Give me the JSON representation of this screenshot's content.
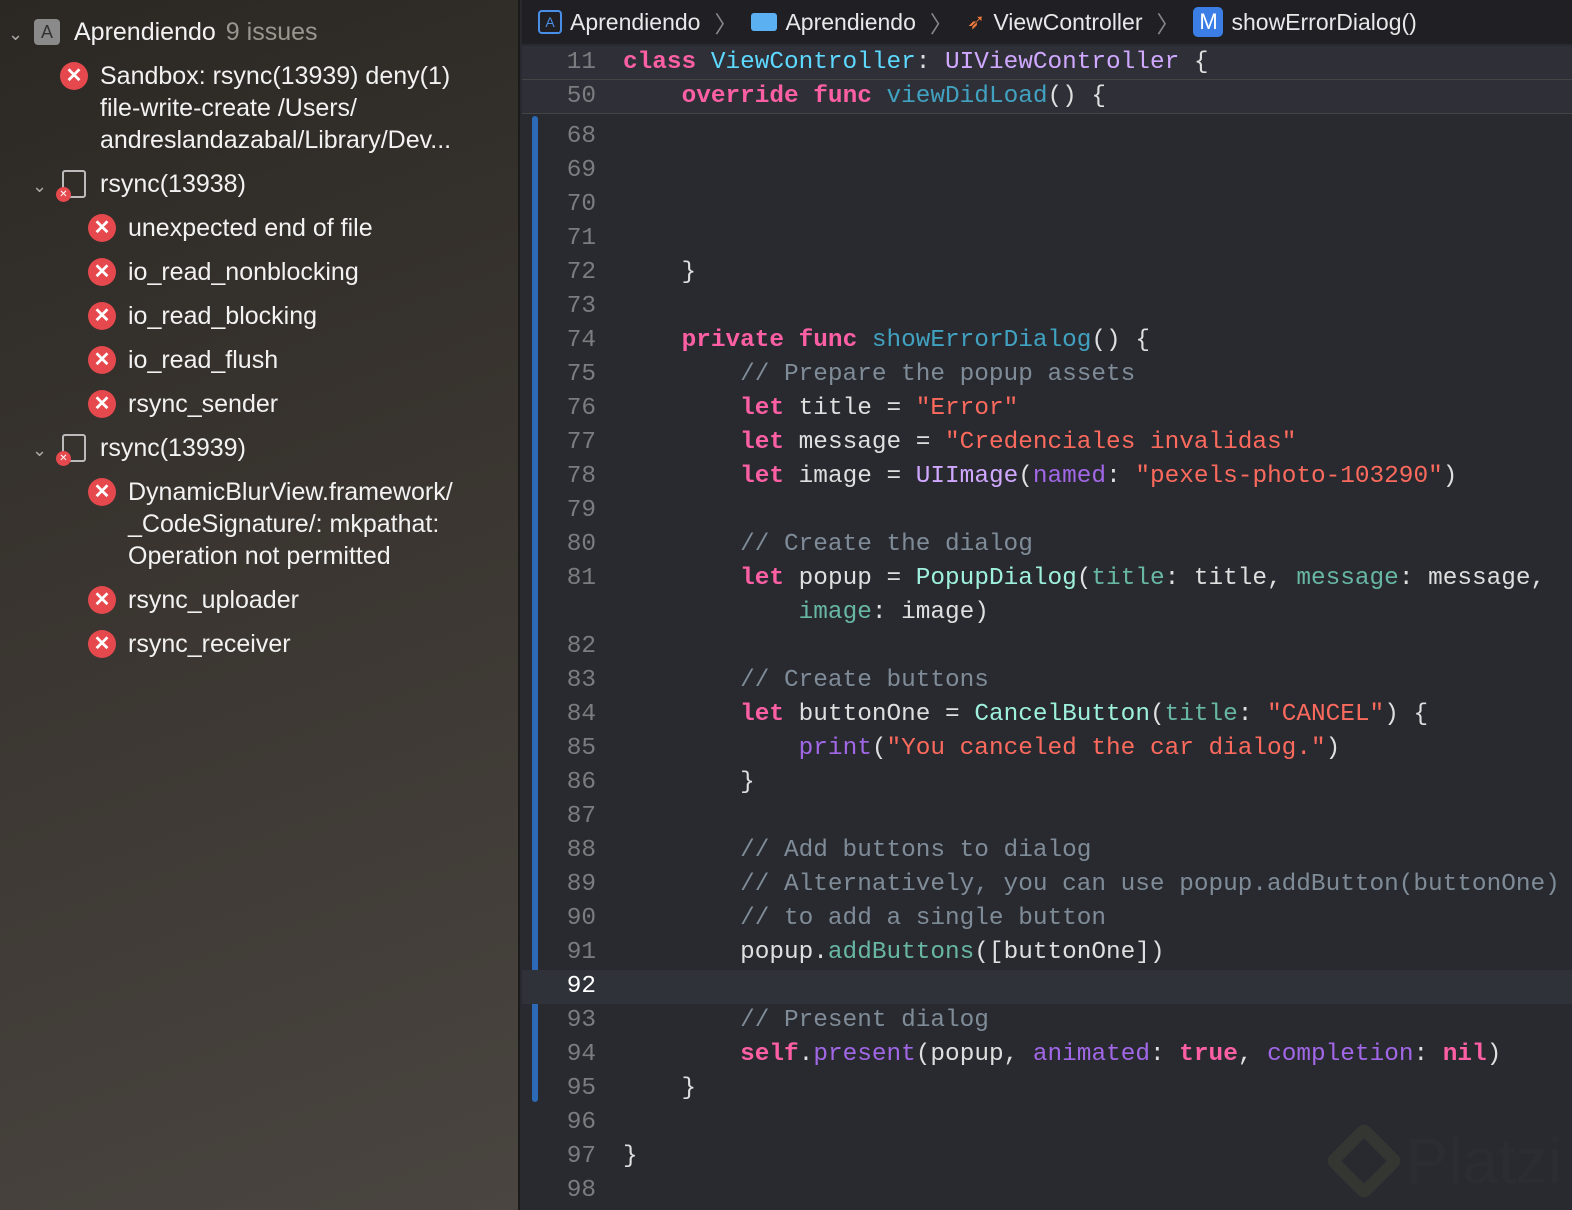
{
  "sidebar": {
    "project": {
      "name": "Aprendiendo",
      "count": "9 issues"
    },
    "top_issue": [
      "Sandbox: rsync(13939) deny(1)",
      "file-write-create /Users/",
      "andreslandazabal/Library/Dev..."
    ],
    "groups": [
      {
        "name": "rsync(13938)",
        "issues": [
          "unexpected end of file",
          "io_read_nonblocking",
          "io_read_blocking",
          "io_read_flush",
          "rsync_sender"
        ]
      },
      {
        "name": "rsync(13939)",
        "issues": [
          [
            "DynamicBlurView.framework/",
            "_CodeSignature/: mkpathat:",
            "Operation not permitted"
          ],
          "rsync_uploader",
          "rsync_receiver"
        ]
      }
    ]
  },
  "breadcrumb": [
    "Aprendiendo",
    "Aprendiendo",
    "ViewController",
    "showErrorDialog()"
  ],
  "breadcrumb_m": "M",
  "watermark": "Platzi",
  "code": [
    {
      "n": "11",
      "sticky": true,
      "t": [
        [
          "kw",
          "class "
        ],
        [
          "td",
          "ViewController"
        ],
        [
          "pl",
          ": "
        ],
        [
          "ty",
          "UIViewController"
        ],
        [
          "pl",
          " {"
        ]
      ]
    },
    {
      "n": "50",
      "sticky": true,
      "t": [
        [
          "pl",
          "    "
        ],
        [
          "kw",
          "override func "
        ],
        [
          "fd",
          "viewDidLoad"
        ],
        [
          "pl",
          "() {"
        ]
      ]
    },
    {
      "n": "68",
      "t": []
    },
    {
      "n": "69",
      "t": []
    },
    {
      "n": "70",
      "t": []
    },
    {
      "n": "71",
      "t": []
    },
    {
      "n": "72",
      "t": [
        [
          "pl",
          "    }"
        ]
      ]
    },
    {
      "n": "73",
      "t": []
    },
    {
      "n": "74",
      "t": [
        [
          "pl",
          "    "
        ],
        [
          "kw",
          "private func "
        ],
        [
          "fd",
          "showErrorDialog"
        ],
        [
          "pl",
          "() {"
        ]
      ]
    },
    {
      "n": "75",
      "t": [
        [
          "com",
          "        // Prepare the popup assets"
        ]
      ]
    },
    {
      "n": "76",
      "t": [
        [
          "pl",
          "        "
        ],
        [
          "kw",
          "let"
        ],
        [
          "pl",
          " title = "
        ],
        [
          "str",
          "\"Error\""
        ]
      ]
    },
    {
      "n": "77",
      "t": [
        [
          "pl",
          "        "
        ],
        [
          "kw",
          "let"
        ],
        [
          "pl",
          " message = "
        ],
        [
          "str",
          "\"Credenciales invalidas\""
        ]
      ]
    },
    {
      "n": "78",
      "t": [
        [
          "pl",
          "        "
        ],
        [
          "kw",
          "let"
        ],
        [
          "pl",
          " image = "
        ],
        [
          "ty",
          "UIImage"
        ],
        [
          "pl",
          "("
        ],
        [
          "sys",
          "named"
        ],
        [
          "pl",
          ": "
        ],
        [
          "str",
          "\"pexels-photo-103290\""
        ],
        [
          "pl",
          ")"
        ]
      ]
    },
    {
      "n": "79",
      "t": []
    },
    {
      "n": "80",
      "t": [
        [
          "com",
          "        // Create the dialog"
        ]
      ]
    },
    {
      "n": "81",
      "t": [
        [
          "pl",
          "        "
        ],
        [
          "kw",
          "let"
        ],
        [
          "pl",
          " popup = "
        ],
        [
          "pt",
          "PopupDialog"
        ],
        [
          "pl",
          "("
        ],
        [
          "lbl",
          "title"
        ],
        [
          "pl",
          ": title, "
        ],
        [
          "lbl",
          "message"
        ],
        [
          "pl",
          ": message,"
        ]
      ]
    },
    {
      "n": "",
      "t": [
        [
          "pl",
          "            "
        ],
        [
          "lbl",
          "image"
        ],
        [
          "pl",
          ": image)"
        ]
      ]
    },
    {
      "n": "82",
      "t": []
    },
    {
      "n": "83",
      "t": [
        [
          "com",
          "        // Create buttons"
        ]
      ]
    },
    {
      "n": "84",
      "t": [
        [
          "pl",
          "        "
        ],
        [
          "kw",
          "let"
        ],
        [
          "pl",
          " buttonOne = "
        ],
        [
          "pt",
          "CancelButton"
        ],
        [
          "pl",
          "("
        ],
        [
          "lbl",
          "title"
        ],
        [
          "pl",
          ": "
        ],
        [
          "str",
          "\"CANCEL\""
        ],
        [
          "pl",
          ") {"
        ]
      ]
    },
    {
      "n": "85",
      "t": [
        [
          "pl",
          "            "
        ],
        [
          "sys",
          "print"
        ],
        [
          "pl",
          "("
        ],
        [
          "str",
          "\"You canceled the car dialog.\""
        ],
        [
          "pl",
          ")"
        ]
      ]
    },
    {
      "n": "86",
      "t": [
        [
          "pl",
          "        }"
        ]
      ]
    },
    {
      "n": "87",
      "t": []
    },
    {
      "n": "88",
      "t": [
        [
          "com",
          "        // Add buttons to dialog"
        ]
      ]
    },
    {
      "n": "89",
      "t": [
        [
          "com",
          "        // Alternatively, you can use popup.addButton(buttonOne)"
        ]
      ]
    },
    {
      "n": "90",
      "t": [
        [
          "com",
          "        // to add a single button"
        ]
      ]
    },
    {
      "n": "91",
      "t": [
        [
          "pl",
          "        popup."
        ],
        [
          "lbl",
          "addButtons"
        ],
        [
          "pl",
          "([buttonOne])"
        ]
      ]
    },
    {
      "n": "92",
      "cur": true,
      "t": []
    },
    {
      "n": "93",
      "t": [
        [
          "com",
          "        // Present dialog"
        ]
      ]
    },
    {
      "n": "94",
      "t": [
        [
          "pl",
          "        "
        ],
        [
          "kw",
          "self"
        ],
        [
          "pl",
          "."
        ],
        [
          "sys",
          "present"
        ],
        [
          "pl",
          "(popup, "
        ],
        [
          "sys",
          "animated"
        ],
        [
          "pl",
          ": "
        ],
        [
          "kw",
          "true"
        ],
        [
          "pl",
          ", "
        ],
        [
          "sys",
          "completion"
        ],
        [
          "pl",
          ": "
        ],
        [
          "kw",
          "nil"
        ],
        [
          "pl",
          ")"
        ]
      ]
    },
    {
      "n": "95",
      "t": [
        [
          "pl",
          "    }"
        ]
      ]
    },
    {
      "n": "96",
      "t": []
    },
    {
      "n": "97",
      "t": [
        [
          "pl",
          "}"
        ]
      ]
    },
    {
      "n": "98",
      "t": []
    }
  ]
}
